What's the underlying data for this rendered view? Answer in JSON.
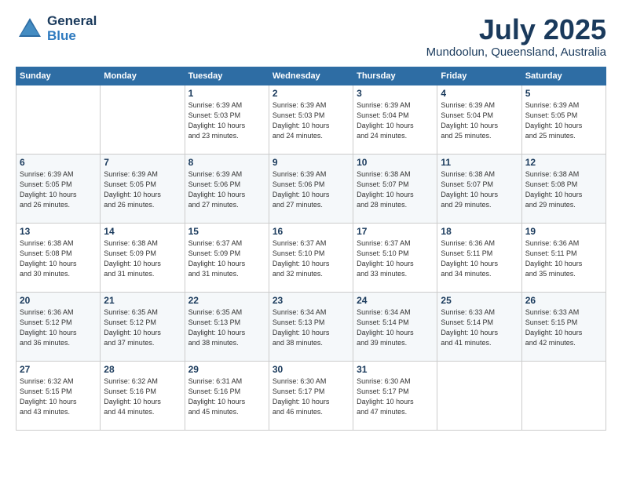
{
  "header": {
    "logo_general": "General",
    "logo_blue": "Blue",
    "month_title": "July 2025",
    "location": "Mundoolun, Queensland, Australia"
  },
  "weekdays": [
    "Sunday",
    "Monday",
    "Tuesday",
    "Wednesday",
    "Thursday",
    "Friday",
    "Saturday"
  ],
  "weeks": [
    [
      {
        "day": "",
        "detail": ""
      },
      {
        "day": "",
        "detail": ""
      },
      {
        "day": "1",
        "detail": "Sunrise: 6:39 AM\nSunset: 5:03 PM\nDaylight: 10 hours\nand 23 minutes."
      },
      {
        "day": "2",
        "detail": "Sunrise: 6:39 AM\nSunset: 5:03 PM\nDaylight: 10 hours\nand 24 minutes."
      },
      {
        "day": "3",
        "detail": "Sunrise: 6:39 AM\nSunset: 5:04 PM\nDaylight: 10 hours\nand 24 minutes."
      },
      {
        "day": "4",
        "detail": "Sunrise: 6:39 AM\nSunset: 5:04 PM\nDaylight: 10 hours\nand 25 minutes."
      },
      {
        "day": "5",
        "detail": "Sunrise: 6:39 AM\nSunset: 5:05 PM\nDaylight: 10 hours\nand 25 minutes."
      }
    ],
    [
      {
        "day": "6",
        "detail": "Sunrise: 6:39 AM\nSunset: 5:05 PM\nDaylight: 10 hours\nand 26 minutes."
      },
      {
        "day": "7",
        "detail": "Sunrise: 6:39 AM\nSunset: 5:05 PM\nDaylight: 10 hours\nand 26 minutes."
      },
      {
        "day": "8",
        "detail": "Sunrise: 6:39 AM\nSunset: 5:06 PM\nDaylight: 10 hours\nand 27 minutes."
      },
      {
        "day": "9",
        "detail": "Sunrise: 6:39 AM\nSunset: 5:06 PM\nDaylight: 10 hours\nand 27 minutes."
      },
      {
        "day": "10",
        "detail": "Sunrise: 6:38 AM\nSunset: 5:07 PM\nDaylight: 10 hours\nand 28 minutes."
      },
      {
        "day": "11",
        "detail": "Sunrise: 6:38 AM\nSunset: 5:07 PM\nDaylight: 10 hours\nand 29 minutes."
      },
      {
        "day": "12",
        "detail": "Sunrise: 6:38 AM\nSunset: 5:08 PM\nDaylight: 10 hours\nand 29 minutes."
      }
    ],
    [
      {
        "day": "13",
        "detail": "Sunrise: 6:38 AM\nSunset: 5:08 PM\nDaylight: 10 hours\nand 30 minutes."
      },
      {
        "day": "14",
        "detail": "Sunrise: 6:38 AM\nSunset: 5:09 PM\nDaylight: 10 hours\nand 31 minutes."
      },
      {
        "day": "15",
        "detail": "Sunrise: 6:37 AM\nSunset: 5:09 PM\nDaylight: 10 hours\nand 31 minutes."
      },
      {
        "day": "16",
        "detail": "Sunrise: 6:37 AM\nSunset: 5:10 PM\nDaylight: 10 hours\nand 32 minutes."
      },
      {
        "day": "17",
        "detail": "Sunrise: 6:37 AM\nSunset: 5:10 PM\nDaylight: 10 hours\nand 33 minutes."
      },
      {
        "day": "18",
        "detail": "Sunrise: 6:36 AM\nSunset: 5:11 PM\nDaylight: 10 hours\nand 34 minutes."
      },
      {
        "day": "19",
        "detail": "Sunrise: 6:36 AM\nSunset: 5:11 PM\nDaylight: 10 hours\nand 35 minutes."
      }
    ],
    [
      {
        "day": "20",
        "detail": "Sunrise: 6:36 AM\nSunset: 5:12 PM\nDaylight: 10 hours\nand 36 minutes."
      },
      {
        "day": "21",
        "detail": "Sunrise: 6:35 AM\nSunset: 5:12 PM\nDaylight: 10 hours\nand 37 minutes."
      },
      {
        "day": "22",
        "detail": "Sunrise: 6:35 AM\nSunset: 5:13 PM\nDaylight: 10 hours\nand 38 minutes."
      },
      {
        "day": "23",
        "detail": "Sunrise: 6:34 AM\nSunset: 5:13 PM\nDaylight: 10 hours\nand 38 minutes."
      },
      {
        "day": "24",
        "detail": "Sunrise: 6:34 AM\nSunset: 5:14 PM\nDaylight: 10 hours\nand 39 minutes."
      },
      {
        "day": "25",
        "detail": "Sunrise: 6:33 AM\nSunset: 5:14 PM\nDaylight: 10 hours\nand 41 minutes."
      },
      {
        "day": "26",
        "detail": "Sunrise: 6:33 AM\nSunset: 5:15 PM\nDaylight: 10 hours\nand 42 minutes."
      }
    ],
    [
      {
        "day": "27",
        "detail": "Sunrise: 6:32 AM\nSunset: 5:15 PM\nDaylight: 10 hours\nand 43 minutes."
      },
      {
        "day": "28",
        "detail": "Sunrise: 6:32 AM\nSunset: 5:16 PM\nDaylight: 10 hours\nand 44 minutes."
      },
      {
        "day": "29",
        "detail": "Sunrise: 6:31 AM\nSunset: 5:16 PM\nDaylight: 10 hours\nand 45 minutes."
      },
      {
        "day": "30",
        "detail": "Sunrise: 6:30 AM\nSunset: 5:17 PM\nDaylight: 10 hours\nand 46 minutes."
      },
      {
        "day": "31",
        "detail": "Sunrise: 6:30 AM\nSunset: 5:17 PM\nDaylight: 10 hours\nand 47 minutes."
      },
      {
        "day": "",
        "detail": ""
      },
      {
        "day": "",
        "detail": ""
      }
    ]
  ]
}
